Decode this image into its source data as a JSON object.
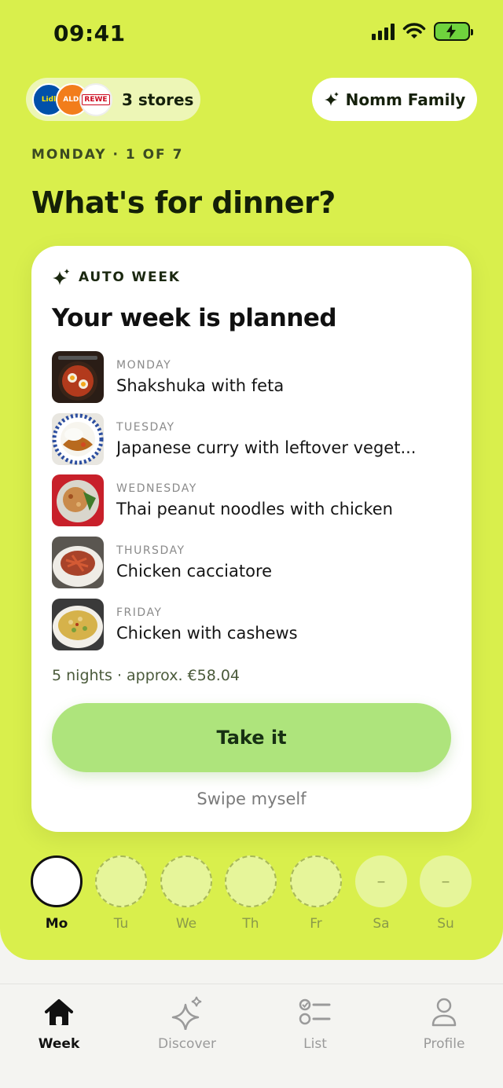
{
  "status_bar": {
    "time": "09:41"
  },
  "header": {
    "stores": {
      "label": "3 stores",
      "logos": [
        {
          "name": "Lidl",
          "text": "Lidl"
        },
        {
          "name": "Aldi",
          "text": "ALDI"
        },
        {
          "name": "Rewe",
          "text": "REWE"
        }
      ]
    },
    "family_label": "Nomm Family"
  },
  "day_label": "MONDAY · 1 OF 7",
  "headline": "What's for dinner?",
  "card": {
    "tag": "AUTO WEEK",
    "title": "Your week is planned",
    "meals": [
      {
        "day": "MONDAY",
        "name": "Shakshuka with feta"
      },
      {
        "day": "TUESDAY",
        "name": "Japanese curry with leftover veget..."
      },
      {
        "day": "WEDNESDAY",
        "name": "Thai peanut noodles with chicken"
      },
      {
        "day": "THURSDAY",
        "name": "Chicken cacciatore"
      },
      {
        "day": "FRIDAY",
        "name": "Chicken with cashews"
      }
    ],
    "summary": "5 nights · approx. €58.04",
    "primary_button": "Take it",
    "secondary_link": "Swipe myself"
  },
  "week_strip": [
    {
      "label": "Mo",
      "state": "active",
      "mark": ""
    },
    {
      "label": "Tu",
      "state": "planned",
      "mark": ""
    },
    {
      "label": "We",
      "state": "planned",
      "mark": ""
    },
    {
      "label": "Th",
      "state": "planned",
      "mark": ""
    },
    {
      "label": "Fr",
      "state": "planned",
      "mark": ""
    },
    {
      "label": "Sa",
      "state": "empty",
      "mark": "–"
    },
    {
      "label": "Su",
      "state": "empty",
      "mark": "–"
    }
  ],
  "nav": [
    {
      "label": "Week",
      "icon": "home-icon",
      "active": true
    },
    {
      "label": "Discover",
      "icon": "sparkle-icon",
      "active": false
    },
    {
      "label": "List",
      "icon": "checklist-icon",
      "active": false
    },
    {
      "label": "Profile",
      "icon": "person-icon",
      "active": false
    }
  ],
  "colors": {
    "accent": "#d9ef4c",
    "button": "#aee47c",
    "card": "#ffffff"
  }
}
